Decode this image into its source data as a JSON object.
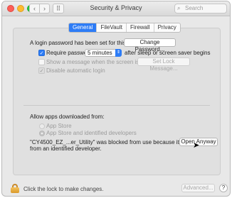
{
  "window": {
    "title": "Security & Privacy",
    "search_placeholder": "Search",
    "nav_back_glyph": "‹",
    "nav_forward_glyph": "›",
    "grid_glyph": "⠿"
  },
  "tabs": [
    {
      "label": "General",
      "active": true
    },
    {
      "label": "FileVault",
      "active": false
    },
    {
      "label": "Firewall",
      "active": false
    },
    {
      "label": "Privacy",
      "active": false
    }
  ],
  "general": {
    "login_password_text": "A login password has been set for this user",
    "change_password_label": "Change Password...",
    "require_password": {
      "label": "Require password",
      "checked": true
    },
    "require_password_delay": "5 minutes",
    "after_sleep_text": "after sleep or screen saver begins",
    "show_message": {
      "label": "Show a message when the screen is locked",
      "checked": false,
      "enabled": false
    },
    "set_lock_message_label": "Set Lock Message...",
    "disable_auto_login": {
      "label": "Disable automatic login",
      "checked": true,
      "enabled": false
    }
  },
  "allow_apps": {
    "heading": "Allow apps downloaded from:",
    "options": [
      {
        "label": "App Store",
        "selected": false
      },
      {
        "label": "App Store and identified developers",
        "selected": true
      }
    ],
    "blocked_message_line1": "\"CY4500_EZ_...er_Utility\" was blocked from use because it is not",
    "blocked_message_line2": "from an identified developer.",
    "open_anyway_label": "Open Anyway"
  },
  "footer": {
    "lock_text": "Click the lock to make changes.",
    "advanced_label": "Advanced...",
    "help_label": "?"
  },
  "colors": {
    "accent": "#2d7cf6",
    "lock": "#e3a93d"
  }
}
